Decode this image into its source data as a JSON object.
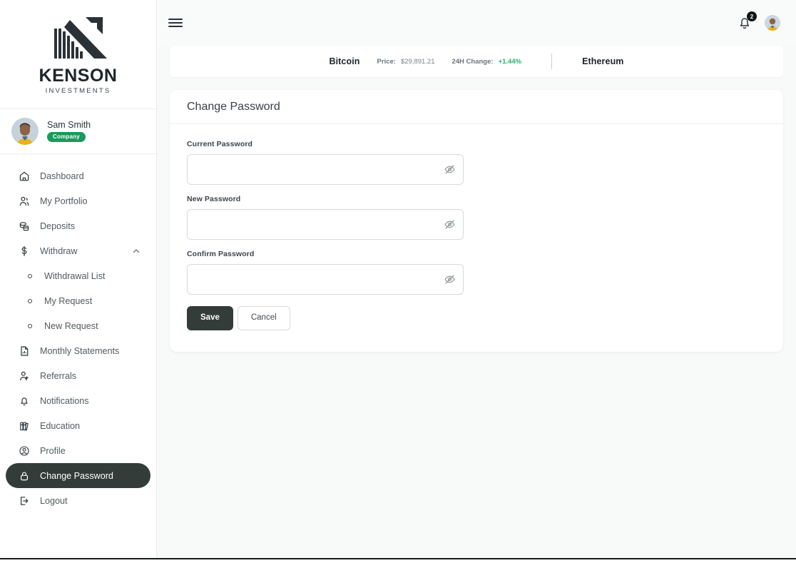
{
  "brand": {
    "name": "KENSON",
    "tagline": "INVESTMENTS",
    "logo_icon": "arrow-bars-logo"
  },
  "profile": {
    "name": "Sam Smith",
    "badge": "Company",
    "badge_color": "#1a9a5c",
    "avatar_icon": "user-avatar"
  },
  "sidebar": {
    "items": [
      {
        "label": "Dashboard",
        "icon": "home-icon",
        "active": false,
        "sub": false
      },
      {
        "label": "My Portfolio",
        "icon": "users-icon",
        "active": false,
        "sub": false
      },
      {
        "label": "Deposits",
        "icon": "coins-icon",
        "active": false,
        "sub": false
      },
      {
        "label": "Withdraw",
        "icon": "dollar-icon",
        "active": false,
        "sub": false,
        "expandable": true,
        "expanded": true
      },
      {
        "label": "Withdrawal List",
        "icon": "bullet-icon",
        "active": false,
        "sub": true
      },
      {
        "label": "My Request",
        "icon": "bullet-icon",
        "active": false,
        "sub": true
      },
      {
        "label": "New Request",
        "icon": "bullet-icon",
        "active": false,
        "sub": true
      },
      {
        "label": "Monthly Statements",
        "icon": "document-icon",
        "active": false,
        "sub": false
      },
      {
        "label": "Referrals",
        "icon": "user-plus-icon",
        "active": false,
        "sub": false
      },
      {
        "label": "Notifications",
        "icon": "bell-icon",
        "active": false,
        "sub": false
      },
      {
        "label": "Education",
        "icon": "books-icon",
        "active": false,
        "sub": false
      },
      {
        "label": "Profile",
        "icon": "user-circle-icon",
        "active": false,
        "sub": false
      },
      {
        "label": "Change Password",
        "icon": "lock-icon",
        "active": true,
        "sub": false
      },
      {
        "label": "Logout",
        "icon": "logout-icon",
        "active": false,
        "sub": false
      }
    ]
  },
  "topbar": {
    "menu_icon": "hamburger-icon",
    "bell_icon": "bell-icon",
    "notification_count": "2",
    "avatar_icon": "user-avatar"
  },
  "ticker": {
    "left_coin": "Bitcoin",
    "price_label": "Price:",
    "price_value": "$29,891.21",
    "change_label": "24H Change:",
    "change_value": "+1.44%",
    "change_color": "#22b573",
    "right_coin": "Ethereum"
  },
  "card": {
    "title": "Change Password",
    "fields": [
      {
        "label": "Current Password",
        "value": "",
        "placeholder": "",
        "toggle_icon": "eye-off-icon"
      },
      {
        "label": "New Password",
        "value": "",
        "placeholder": "",
        "toggle_icon": "eye-off-icon"
      },
      {
        "label": "Confirm Password",
        "value": "",
        "placeholder": "",
        "toggle_icon": "eye-off-icon"
      }
    ],
    "save_label": "Save",
    "cancel_label": "Cancel",
    "save_color": "#333c38"
  }
}
